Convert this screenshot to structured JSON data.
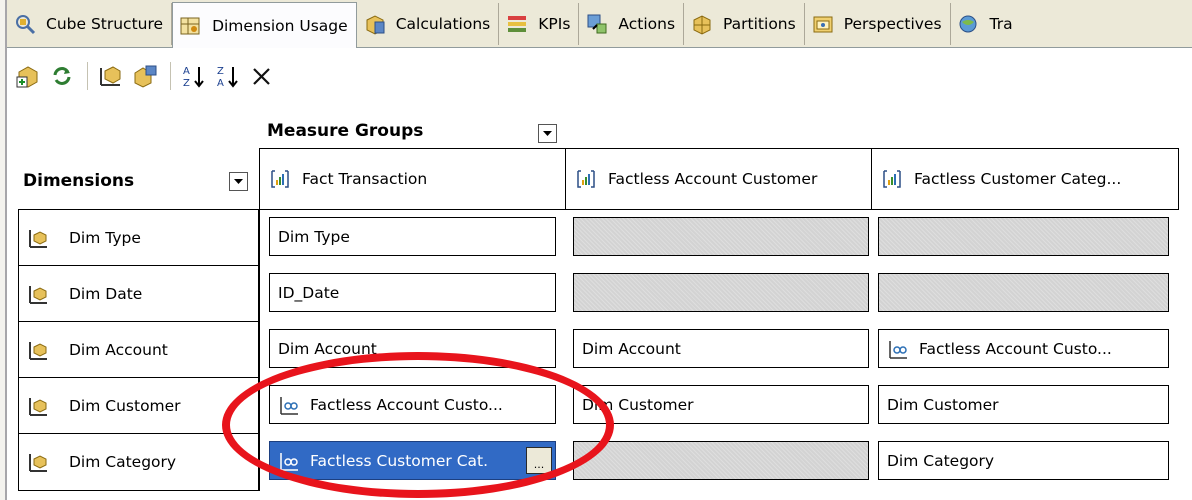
{
  "tabs": [
    {
      "label": "Cube Structure",
      "icon": "cube-structure-icon",
      "active": false
    },
    {
      "label": "Dimension Usage",
      "icon": "dimension-usage-icon",
      "active": true
    },
    {
      "label": "Calculations",
      "icon": "calculations-icon",
      "active": false
    },
    {
      "label": "KPIs",
      "icon": "kpis-icon",
      "active": false
    },
    {
      "label": "Actions",
      "icon": "actions-icon",
      "active": false
    },
    {
      "label": "Partitions",
      "icon": "partitions-icon",
      "active": false
    },
    {
      "label": "Perspectives",
      "icon": "perspectives-icon",
      "active": false
    },
    {
      "label": "Tra",
      "icon": "translations-icon",
      "active": false
    }
  ],
  "toolbar": {
    "buttons": [
      "add-cube-dimension-icon",
      "refresh-icon",
      "design-relationship-icon",
      "show-all-icon",
      "sort-ascending-icon",
      "sort-descending-icon",
      "delete-icon"
    ]
  },
  "grid": {
    "measure_groups_title": "Measure Groups",
    "dimensions_title": "Dimensions",
    "measure_groups": [
      "Fact Transaction",
      "Factless Account Customer",
      "Factless Customer Categ..."
    ],
    "dimensions": [
      "Dim Type",
      "Dim Date",
      "Dim Account",
      "Dim Customer",
      "Dim Category"
    ],
    "cells": [
      [
        {
          "text": "Dim Type",
          "kind": "regular"
        },
        {
          "text": "",
          "kind": "empty"
        },
        {
          "text": "",
          "kind": "empty"
        }
      ],
      [
        {
          "text": "ID_Date",
          "kind": "regular"
        },
        {
          "text": "",
          "kind": "empty"
        },
        {
          "text": "",
          "kind": "empty"
        }
      ],
      [
        {
          "text": "Dim Account",
          "kind": "regular"
        },
        {
          "text": "Dim Account",
          "kind": "regular"
        },
        {
          "text": "Factless Account Custo...",
          "kind": "many-to-many"
        }
      ],
      [
        {
          "text": "Factless Account Custo...",
          "kind": "many-to-many"
        },
        {
          "text": "Dim Customer",
          "kind": "regular"
        },
        {
          "text": "Dim Customer",
          "kind": "regular"
        }
      ],
      [
        {
          "text": "Factless Customer Cat.",
          "kind": "many-to-many-selected"
        },
        {
          "text": "",
          "kind": "empty"
        },
        {
          "text": "Dim Category",
          "kind": "regular"
        }
      ]
    ],
    "ellipsis_label": "...",
    "highlight_color": "#e8141c",
    "selection_color": "#316ac5"
  }
}
